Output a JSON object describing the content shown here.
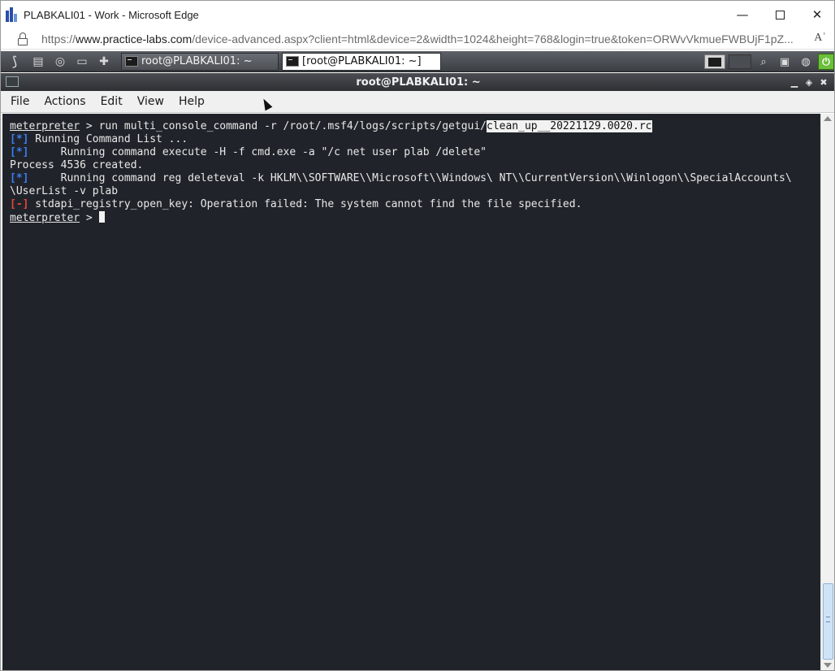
{
  "browser": {
    "window_title": "PLABKALI01 - Work - Microsoft Edge",
    "url_prefix": "https://",
    "url_host": "www.practice-labs.com",
    "url_path": "/device-advanced.aspx?client=html&device=2&width=1024&height=768&login=true&token=ORWvVkmueFWBUjF1pZ...",
    "controls": {
      "minimize": "—",
      "close": "✕"
    },
    "read_aloud_icon": "Aʾ"
  },
  "taskbar": {
    "tasks": [
      {
        "label": "root@PLABKALI01: ~"
      },
      {
        "label": "[root@PLABKALI01: ~]"
      }
    ]
  },
  "terminal_window": {
    "title": "root@PLABKALI01: ~",
    "menu": [
      "File",
      "Actions",
      "Edit",
      "View",
      "Help"
    ]
  },
  "terminal": {
    "line1": {
      "prompt": "meterpreter",
      "text": " > run multi_console_command -r /root/.msf4/logs/scripts/getgui/",
      "highlight": "clean_up__20221129.0020.rc"
    },
    "line2": {
      "tag": "[*]",
      "text": " Running Command List ..."
    },
    "line3": {
      "tag": "[*]",
      "text": "     Running command execute -H -f cmd.exe -a \"/c net user plab /delete\""
    },
    "line4": {
      "text": "Process 4536 created."
    },
    "line5": {
      "tag": "[*]",
      "text": "     Running command reg deleteval -k HKLM\\\\SOFTWARE\\\\Microsoft\\\\Windows\\ NT\\\\CurrentVersion\\\\Winlogon\\\\SpecialAccounts\\"
    },
    "line6": {
      "text": "\\UserList -v plab"
    },
    "line7": {
      "tag": "[-]",
      "text": " stdapi_registry_open_key: Operation failed: The system cannot find the file specified."
    },
    "line8": {
      "prompt": "meterpreter",
      "text": " > "
    }
  },
  "colors": {
    "terminal_bg": "#20242a",
    "info_tag": "#3d7bf0",
    "error_tag": "#e2453a"
  }
}
